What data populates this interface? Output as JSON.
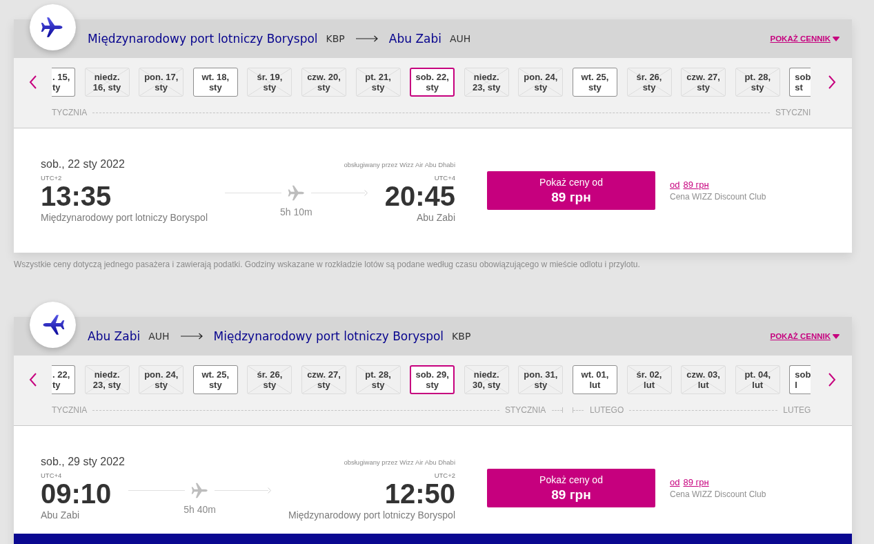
{
  "routes": [
    {
      "kind": "outbound",
      "origin": {
        "name": "Międzynarodowy port lotniczy Boryspol",
        "code": "KBP"
      },
      "destination": {
        "name": "Abu Zabi",
        "code": "AUH"
      },
      "price_list_link": "POKAŻ CENNIK",
      "date_strip": {
        "months": [
          {
            "start_label": "TYCZNIA",
            "end_label": "STYCZNI",
            "days": [
              {
                "lines": [
                  ". 15,",
                  "ty"
                ],
                "kind": "cut_left",
                "available": true,
                "selected": false
              },
              {
                "lines": [
                  "niedz.",
                  "16, sty"
                ],
                "kind": "full",
                "available": false,
                "selected": false
              },
              {
                "lines": [
                  "pon. 17,",
                  "sty"
                ],
                "kind": "full",
                "available": false,
                "selected": false
              },
              {
                "lines": [
                  "wt. 18,",
                  "sty"
                ],
                "kind": "full",
                "available": true,
                "selected": false
              },
              {
                "lines": [
                  "śr. 19,",
                  "sty"
                ],
                "kind": "full",
                "available": false,
                "selected": false
              },
              {
                "lines": [
                  "czw. 20,",
                  "sty"
                ],
                "kind": "full",
                "available": false,
                "selected": false
              },
              {
                "lines": [
                  "pt. 21,",
                  "sty"
                ],
                "kind": "full",
                "available": false,
                "selected": false
              },
              {
                "lines": [
                  "sob. 22,",
                  "sty"
                ],
                "kind": "full",
                "available": true,
                "selected": true
              },
              {
                "lines": [
                  "niedz.",
                  "23, sty"
                ],
                "kind": "full",
                "available": false,
                "selected": false
              },
              {
                "lines": [
                  "pon. 24,",
                  "sty"
                ],
                "kind": "full",
                "available": false,
                "selected": false
              },
              {
                "lines": [
                  "wt. 25,",
                  "sty"
                ],
                "kind": "full",
                "available": true,
                "selected": false
              },
              {
                "lines": [
                  "śr. 26,",
                  "sty"
                ],
                "kind": "full",
                "available": false,
                "selected": false
              },
              {
                "lines": [
                  "czw. 27,",
                  "sty"
                ],
                "kind": "full",
                "available": false,
                "selected": false
              },
              {
                "lines": [
                  "pt. 28,",
                  "sty"
                ],
                "kind": "full",
                "available": false,
                "selected": false
              },
              {
                "lines": [
                  "sob",
                  "st"
                ],
                "kind": "cut_right",
                "available": true,
                "selected": false
              }
            ]
          }
        ]
      },
      "flight": {
        "date": "sob., 22 sty 2022",
        "operator": "obsługiwany przez Wizz Air Abu Dhabi",
        "departure": {
          "utc": "UTC+2",
          "time": "13:35",
          "airport": "Międzynarodowy port lotniczy Boryspol"
        },
        "duration": "5h 10m",
        "arrival": {
          "utc": "UTC+4",
          "time": "20:45",
          "airport": "Abu Zabi"
        },
        "price_button": {
          "label": "Pokaż ceny od",
          "price": "89 грн"
        },
        "club_price": {
          "prefix": "od",
          "price": "89 грн",
          "note": "Cena WIZZ Discount Club"
        }
      },
      "note": "Wszystkie ceny dotyczą jednego pasażera i zawierają podatki. Godziny wskazane w rozkładzie lotów są podane według czasu obowiązującego w mieście odlotu i przylotu."
    },
    {
      "kind": "return",
      "origin": {
        "name": "Abu Zabi",
        "code": "AUH"
      },
      "destination": {
        "name": "Międzynarodowy port lotniczy Boryspol",
        "code": "KBP"
      },
      "price_list_link": "POKAŻ CENNIK",
      "date_strip": {
        "months": [
          {
            "start_label": "TYCZNIA",
            "end_label": "STYCZNIA",
            "days": [
              {
                "lines": [
                  ". 22,",
                  "ty"
                ],
                "kind": "cut_left",
                "available": true,
                "selected": false
              },
              {
                "lines": [
                  "niedz.",
                  "23, sty"
                ],
                "kind": "full",
                "available": false,
                "selected": false
              },
              {
                "lines": [
                  "pon. 24,",
                  "sty"
                ],
                "kind": "full",
                "available": false,
                "selected": false
              },
              {
                "lines": [
                  "wt. 25,",
                  "sty"
                ],
                "kind": "full",
                "available": true,
                "selected": false
              },
              {
                "lines": [
                  "śr. 26,",
                  "sty"
                ],
                "kind": "full",
                "available": false,
                "selected": false
              },
              {
                "lines": [
                  "czw. 27,",
                  "sty"
                ],
                "kind": "full",
                "available": false,
                "selected": false
              },
              {
                "lines": [
                  "pt. 28,",
                  "sty"
                ],
                "kind": "full",
                "available": false,
                "selected": false
              },
              {
                "lines": [
                  "sob. 29,",
                  "sty"
                ],
                "kind": "full",
                "available": true,
                "selected": true
              },
              {
                "lines": [
                  "niedz.",
                  "30, sty"
                ],
                "kind": "full",
                "available": false,
                "selected": false
              },
              {
                "lines": [
                  "pon. 31,",
                  "sty"
                ],
                "kind": "full",
                "available": false,
                "selected": false
              }
            ]
          },
          {
            "start_label": "LUTEGO",
            "end_label": "LUTEG",
            "days": [
              {
                "lines": [
                  "wt. 01,",
                  "lut"
                ],
                "kind": "full",
                "available": true,
                "selected": false
              },
              {
                "lines": [
                  "śr. 02,",
                  "lut"
                ],
                "kind": "full",
                "available": false,
                "selected": false
              },
              {
                "lines": [
                  "czw. 03,",
                  "lut"
                ],
                "kind": "full",
                "available": false,
                "selected": false
              },
              {
                "lines": [
                  "pt. 04,",
                  "lut"
                ],
                "kind": "full",
                "available": false,
                "selected": false
              },
              {
                "lines": [
                  "sob",
                  "l"
                ],
                "kind": "cut_right",
                "available": true,
                "selected": false
              }
            ]
          }
        ]
      },
      "flight": {
        "date": "sob., 29 sty 2022",
        "operator": "obsługiwany przez Wizz Air Abu Dhabi",
        "departure": {
          "utc": "UTC+4",
          "time": "09:10",
          "airport": "Abu Zabi"
        },
        "duration": "5h 40m",
        "arrival": {
          "utc": "UTC+2",
          "time": "12:50",
          "airport": "Międzynarodowy port lotniczy Boryspol"
        },
        "price_button": {
          "label": "Pokaż ceny od",
          "price": "89 грн"
        },
        "club_price": {
          "prefix": "od",
          "price": "89 грн",
          "note": "Cena WIZZ Discount Club"
        }
      }
    }
  ]
}
